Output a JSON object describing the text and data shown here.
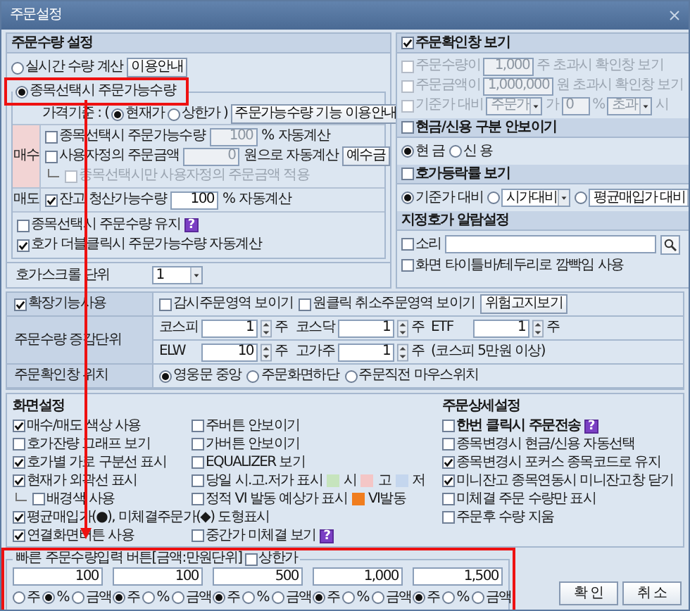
{
  "window": {
    "title": "주문설정"
  },
  "order_qty": {
    "title": "주문수량 설정",
    "realtime": {
      "label": "실시간 수량 계산",
      "selected": false
    },
    "guide_button": "이용안내",
    "on_select": {
      "label": "종목선택시 주문가능수량",
      "selected": true
    },
    "price_basis": {
      "label": "가격기준 : (",
      "options": [
        {
          "label": "현재가",
          "selected": true
        },
        {
          "label": "상한가",
          "selected": false
        }
      ],
      "close": ")"
    },
    "feature_button": "주문가능수량 기능 이용안내",
    "sides": [
      {
        "label": "매수",
        "color": "#f2d4d4",
        "rows": [
          {
            "kind": "percent",
            "label": "종목선택시 주문가능수량",
            "checked": false,
            "disabled": true,
            "value": "100",
            "unit": "%",
            "suffix": "자동계산"
          },
          {
            "kind": "amount",
            "label": "사용자정의 주문금액",
            "checked": false,
            "disabled": true,
            "value": "0",
            "suffix": "원으로 자동계산",
            "button": "예수금"
          },
          {
            "kind": "sub",
            "label": "종목선택시만 사용자정의 주문금액 적용",
            "checked": false,
            "disabled": true
          }
        ]
      },
      {
        "label": "매도",
        "color": "#d3dfec",
        "rows": [
          {
            "kind": "percent",
            "label": "잔고 청산가능수량",
            "checked": true,
            "disabled": false,
            "value": "100",
            "unit": "%",
            "suffix": "자동계산"
          }
        ]
      }
    ],
    "options": [
      {
        "label": "종목선택시 주문수량 유지",
        "checked": false,
        "help": "?"
      },
      {
        "label": "호가 더블클릭시 주문가능수량 자동계산",
        "checked": true
      }
    ],
    "scroll": {
      "label": "호가스크롤 단위",
      "value": "1"
    }
  },
  "confirm": {
    "title": "주문확인창 보기",
    "checked": true,
    "rows": [
      {
        "kind": "threshold",
        "label": "주문수량이",
        "checked": false,
        "disabled": true,
        "value": "1,000",
        "suffix": "주 초과시 확인창 보기"
      },
      {
        "kind": "threshold",
        "label": "주문금액이",
        "checked": false,
        "disabled": true,
        "value": "1,000,000",
        "suffix": "원 초과시 확인창 보기"
      },
      {
        "kind": "basis",
        "label": "기준가 대비",
        "checked": false,
        "disabled": true,
        "select": "주문가",
        "mid": "가",
        "value": "0",
        "unit": "%",
        "select2": "초과",
        "suffix": "시"
      }
    ]
  },
  "cash_credit": {
    "title": "현금/신용 구분 안보이기",
    "checked": false,
    "options": [
      {
        "label": "현 금",
        "selected": true
      },
      {
        "label": "신 용",
        "selected": false
      }
    ]
  },
  "change_rate": {
    "title": "호가등락률 보기",
    "checked": false,
    "options": [
      {
        "kind": "text",
        "label": "기준가 대비",
        "selected": true
      },
      {
        "kind": "select",
        "label": "시가대비",
        "selected": false
      },
      {
        "kind": "select",
        "label": "평균매입가 대비",
        "selected": false
      }
    ]
  },
  "alarm": {
    "title": "지정호가 알람설정",
    "sound": {
      "label": "소리",
      "checked": false
    },
    "blink": {
      "label": "화면 타이틀바/테두리로 깜빡임 사용",
      "checked": false
    }
  },
  "extended": {
    "enable": {
      "label": "확장기능사용",
      "checked": true
    },
    "options": [
      {
        "label": "감시주문영역 보이기",
        "checked": false
      },
      {
        "label": "원클릭 취소주문영역 보이기",
        "checked": false
      }
    ],
    "risk_button": "위험고지보기",
    "step": {
      "label": "주문수량 증감단위",
      "lines": [
        [
          {
            "name": "코스피",
            "value": "1",
            "unit": "주"
          },
          {
            "name": "코스닥",
            "value": "1",
            "unit": "주"
          },
          {
            "name": "ETF",
            "value": "1",
            "unit": "주"
          }
        ],
        [
          {
            "name": "ELW",
            "value": "10",
            "unit": "주"
          },
          {
            "name": "고가주",
            "value": "1",
            "unit": "주"
          }
        ]
      ],
      "note": "(코스피 5만원 이상)"
    },
    "position": {
      "label": "주문확인창 위치",
      "options": [
        {
          "label": "영웅문 중앙",
          "selected": true
        },
        {
          "label": "주문화면하단",
          "selected": false
        },
        {
          "label": "주문직전 마우스위치",
          "selected": false
        }
      ]
    }
  },
  "screen": {
    "title": "화면설정",
    "items": [
      {
        "kind": "check",
        "label": "매수/매도 색상 사용",
        "checked": true
      },
      {
        "kind": "check",
        "label": "주버튼 안보이기",
        "checked": false
      },
      {
        "kind": "check",
        "label": "호가잔량 그래프 보기",
        "checked": false
      },
      {
        "kind": "check",
        "label": "가버튼 안보이기",
        "checked": false
      },
      {
        "kind": "check",
        "label": "호가별 가로 구분선 표시",
        "checked": true
      },
      {
        "kind": "check",
        "label": "EQUALIZER 보기",
        "checked": false
      },
      {
        "kind": "check",
        "label": "현재가 외곽선 표시",
        "checked": true
      },
      {
        "kind": "colors",
        "label": "당일 시.고.저가 표시",
        "checked": false,
        "swatches": [
          {
            "label": "시",
            "color": "#c6e4bd"
          },
          {
            "label": "고",
            "color": "#f4c6c6"
          },
          {
            "label": "저",
            "color": "#c4d6ee"
          }
        ]
      },
      {
        "kind": "sub",
        "label": "배경색 사용",
        "checked": false
      },
      {
        "kind": "colors",
        "label": "정적 VI 발동 예상가 표시",
        "checked": false,
        "swatches": [
          {
            "label": "VI발동",
            "color": "#f07d1e"
          }
        ]
      },
      {
        "kind": "wide",
        "label": "평균매입가(●), 미체결주문가(◆) 도형표시",
        "checked": true
      },
      {
        "kind": "check",
        "label": "연결화면버튼 사용",
        "checked": true
      },
      {
        "kind": "help",
        "label": "중간가 미체결 보기",
        "checked": false,
        "help": "?"
      }
    ]
  },
  "detail": {
    "title": "주문상세설정",
    "items": [
      {
        "kind": "help",
        "label": "한번 클릭시 주문전송",
        "checked": false,
        "help": "?"
      },
      {
        "kind": "check",
        "label": "종목변경시 현금/신용 자동선택",
        "checked": false
      },
      {
        "kind": "check",
        "label": "종목변경시 포커스 종목코드로 유지",
        "checked": true
      },
      {
        "kind": "check",
        "label": "미니잔고 종목연동시 미니잔고창 닫기",
        "checked": true
      },
      {
        "kind": "check",
        "label": "미체결 주문 수량만 표시",
        "checked": false
      },
      {
        "kind": "check",
        "label": "주문후 수량 지움",
        "checked": false
      }
    ]
  },
  "quick": {
    "title": "빠른 주문수량입력 버튼[금액:만원단위]",
    "upper": {
      "label": "상한가",
      "checked": false
    },
    "buttons": [
      {
        "value": "100",
        "units": [
          {
            "label": "주",
            "selected": false
          },
          {
            "label": "%",
            "selected": true
          },
          {
            "label": "금액",
            "selected": false
          }
        ]
      },
      {
        "value": "100",
        "units": [
          {
            "label": "주",
            "selected": true
          },
          {
            "label": "%",
            "selected": false
          },
          {
            "label": "금액",
            "selected": false
          }
        ]
      },
      {
        "value": "500",
        "units": [
          {
            "label": "주",
            "selected": true
          },
          {
            "label": "%",
            "selected": false
          },
          {
            "label": "금액",
            "selected": false
          }
        ]
      },
      {
        "value": "1,000",
        "units": [
          {
            "label": "주",
            "selected": true
          },
          {
            "label": "%",
            "selected": false
          },
          {
            "label": "금액",
            "selected": false
          }
        ]
      },
      {
        "value": "1,500",
        "units": [
          {
            "label": "주",
            "selected": true
          },
          {
            "label": "%",
            "selected": false
          },
          {
            "label": "금액",
            "selected": false
          }
        ]
      }
    ]
  },
  "buttons": [
    "확 인",
    "취 소"
  ]
}
